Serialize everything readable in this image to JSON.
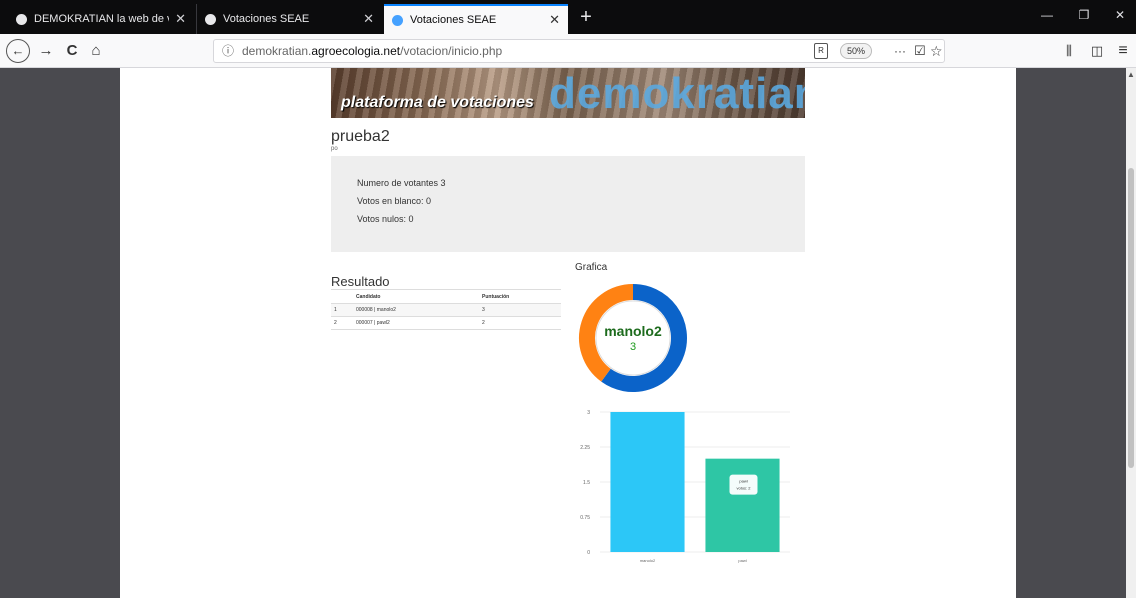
{
  "browser": {
    "tabs": [
      {
        "title": "DEMOKRATIAN la web de vota",
        "close": "✕",
        "active": false
      },
      {
        "title": "Votaciones SEAE",
        "close": "✕",
        "active": false
      },
      {
        "title": "Votaciones SEAE",
        "close": "✕",
        "active": true
      }
    ],
    "new_tab": "+",
    "window_controls": {
      "minimize": "—",
      "restore": "❐",
      "close": "✕"
    },
    "nav": {
      "back": "←",
      "forward": "→",
      "reload": "C",
      "home": "⌂"
    },
    "url": {
      "prefix": "demokratian.",
      "domain": "agroecologia.net",
      "path": "/votacion/inicio.php"
    },
    "info_icon": "ⓘ",
    "reader": "R",
    "zoom": "50%",
    "more": "···",
    "pocket": "☑",
    "star": "☆",
    "library": "⫼",
    "sidebar": "◫",
    "menu": "≡"
  },
  "banner": {
    "subtitle": "plataforma de votaciones",
    "brand": "demokratian"
  },
  "vote": {
    "title": "prueba2",
    "subtitle": "po",
    "stats": [
      "Numero de votantes 3",
      "Votos en blanco: 0",
      "Votos nulos: 0"
    ]
  },
  "results": {
    "title": "Resultado",
    "columns": [
      "",
      "Candidato",
      "Puntuación"
    ],
    "rows": [
      {
        "n": "1",
        "candidate": "000008 | manolo2",
        "score": "3"
      },
      {
        "n": "2",
        "candidate": "000007 | pawl2",
        "score": "2"
      }
    ]
  },
  "grafica_title": "Grafica",
  "chart_data": [
    {
      "type": "pie",
      "categories": [
        "manolo2",
        "pawl2"
      ],
      "values": [
        3,
        2
      ],
      "center_label": "manolo2",
      "center_value": "3",
      "colors": [
        "#0b63c9",
        "#ff8213"
      ]
    },
    {
      "type": "bar",
      "categories": [
        "manolo2",
        "pawl"
      ],
      "values": [
        3,
        2
      ],
      "yticks": [
        "3",
        "2.25",
        "1.5",
        "0.75",
        "0"
      ],
      "ylim": [
        0,
        3
      ],
      "colors": [
        "#2cc7f7",
        "#2ec6a5"
      ],
      "tooltip": {
        "title": "pawl",
        "text": "votos: 2"
      }
    }
  ],
  "colors": {
    "stats_bg": "#eeeeee",
    "tab_active_border": "#0a84ff"
  }
}
